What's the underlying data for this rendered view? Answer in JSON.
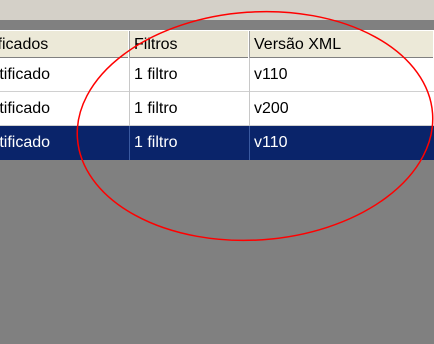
{
  "table": {
    "columns": [
      {
        "label": "ificados"
      },
      {
        "label": "Filtros"
      },
      {
        "label": "Versão XML"
      }
    ],
    "rows": [
      {
        "certificados": "rtificado",
        "filtros": "1 filtro",
        "versao_xml": "v110",
        "selected": false
      },
      {
        "certificados": "rtificado",
        "filtros": "1 filtro",
        "versao_xml": "v200",
        "selected": false
      },
      {
        "certificados": "rtificado",
        "filtros": "1 filtro",
        "versao_xml": "v110",
        "selected": true
      }
    ]
  },
  "colors": {
    "header_bg": "#ece9d8",
    "selected_row_bg": "#0a246a",
    "grid_empty_bg": "#808080",
    "annotation_stroke": "#ff0000"
  }
}
